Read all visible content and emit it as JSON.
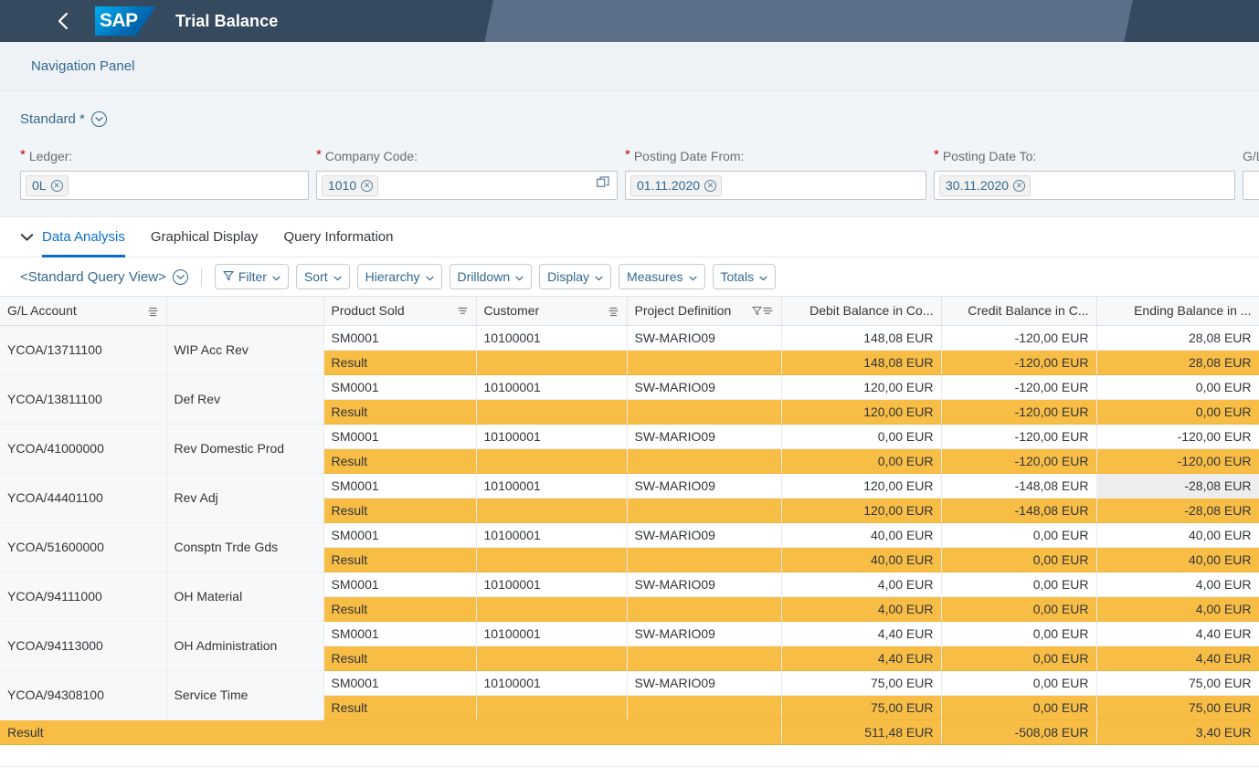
{
  "shell": {
    "back_icon": "chevron-left-icon",
    "logo_text": "SAP",
    "title": "Trial Balance"
  },
  "nav_panel": {
    "label": "Navigation Panel"
  },
  "filter_bar": {
    "variant": "Standard *",
    "variant_icon": "chevron-down-circle-icon",
    "fields": [
      {
        "label": "Ledger:",
        "required": true,
        "value": "0L",
        "has_value_help": false
      },
      {
        "label": "Company Code:",
        "required": true,
        "value": "1010",
        "has_value_help": true
      },
      {
        "label": "Posting Date From:",
        "required": true,
        "value": "01.11.2020",
        "has_value_help": false
      },
      {
        "label": "Posting Date To:",
        "required": true,
        "value": "30.11.2020",
        "has_value_help": false
      },
      {
        "label": "G/L Ac",
        "required": false,
        "value": "",
        "has_value_help": false
      }
    ]
  },
  "tabs": {
    "expander_icon": "chevron-down-icon",
    "items": [
      {
        "label": "Data Analysis",
        "selected": true
      },
      {
        "label": "Graphical Display",
        "selected": false
      },
      {
        "label": "Query Information",
        "selected": false
      }
    ]
  },
  "toolbar": {
    "query_view": "<Standard Query View>",
    "query_view_icon": "chevron-down-circle-icon",
    "buttons": [
      {
        "label": "Filter",
        "icon": "filter-icon"
      },
      {
        "label": "Sort",
        "icon": ""
      },
      {
        "label": "Hierarchy",
        "icon": ""
      },
      {
        "label": "Drilldown",
        "icon": ""
      },
      {
        "label": "Display",
        "icon": ""
      },
      {
        "label": "Measures",
        "icon": ""
      },
      {
        "label": "Totals",
        "icon": ""
      }
    ]
  },
  "table": {
    "columns": [
      {
        "label": "G/L Account",
        "icon": "hierarchy-sort-icon",
        "align": "left"
      },
      {
        "label": "",
        "icon": "",
        "align": "left"
      },
      {
        "label": "Product Sold",
        "icon": "sort-descending-icon",
        "align": "left"
      },
      {
        "label": "Customer",
        "icon": "hierarchy-sort-icon",
        "align": "left"
      },
      {
        "label": "Project Definition",
        "icon": "filter-sort-icon",
        "align": "left"
      },
      {
        "label": "Debit Balance in Co...",
        "icon": "",
        "align": "right"
      },
      {
        "label": "Credit Balance in C...",
        "icon": "",
        "align": "right"
      },
      {
        "label": "Ending Balance in ...",
        "icon": "",
        "align": "right"
      }
    ],
    "result_label": "Result",
    "groups": [
      {
        "account": "YCOA/13711100",
        "account_text": "WIP Acc Rev",
        "leaf": {
          "product": "SM0001",
          "customer": "10100001",
          "project": "SW-MARIO09",
          "debit": "148,08 EUR",
          "credit": "-120,00 EUR",
          "ending": "28,08 EUR",
          "ending_selected": false
        },
        "result": {
          "debit": "148,08 EUR",
          "credit": "-120,00 EUR",
          "ending": "28,08 EUR"
        }
      },
      {
        "account": "YCOA/13811100",
        "account_text": "Def Rev",
        "leaf": {
          "product": "SM0001",
          "customer": "10100001",
          "project": "SW-MARIO09",
          "debit": "120,00 EUR",
          "credit": "-120,00 EUR",
          "ending": "0,00 EUR",
          "ending_selected": false
        },
        "result": {
          "debit": "120,00 EUR",
          "credit": "-120,00 EUR",
          "ending": "0,00 EUR"
        }
      },
      {
        "account": "YCOA/41000000",
        "account_text": "Rev Domestic Prod",
        "leaf": {
          "product": "SM0001",
          "customer": "10100001",
          "project": "SW-MARIO09",
          "debit": "0,00 EUR",
          "credit": "-120,00 EUR",
          "ending": "-120,00 EUR",
          "ending_selected": false
        },
        "result": {
          "debit": "0,00 EUR",
          "credit": "-120,00 EUR",
          "ending": "-120,00 EUR"
        }
      },
      {
        "account": "YCOA/44401100",
        "account_text": "Rev Adj",
        "leaf": {
          "product": "SM0001",
          "customer": "10100001",
          "project": "SW-MARIO09",
          "debit": "120,00 EUR",
          "credit": "-148,08 EUR",
          "ending": "-28,08 EUR",
          "ending_selected": true
        },
        "result": {
          "debit": "120,00 EUR",
          "credit": "-148,08 EUR",
          "ending": "-28,08 EUR"
        }
      },
      {
        "account": "YCOA/51600000",
        "account_text": "Consptn Trde Gds",
        "leaf": {
          "product": "SM0001",
          "customer": "10100001",
          "project": "SW-MARIO09",
          "debit": "40,00 EUR",
          "credit": "0,00 EUR",
          "ending": "40,00 EUR",
          "ending_selected": false
        },
        "result": {
          "debit": "40,00 EUR",
          "credit": "0,00 EUR",
          "ending": "40,00 EUR"
        }
      },
      {
        "account": "YCOA/94111000",
        "account_text": "OH Material",
        "leaf": {
          "product": "SM0001",
          "customer": "10100001",
          "project": "SW-MARIO09",
          "debit": "4,00 EUR",
          "credit": "0,00 EUR",
          "ending": "4,00 EUR",
          "ending_selected": false
        },
        "result": {
          "debit": "4,00 EUR",
          "credit": "0,00 EUR",
          "ending": "4,00 EUR"
        }
      },
      {
        "account": "YCOA/94113000",
        "account_text": "OH Administration",
        "leaf": {
          "product": "SM0001",
          "customer": "10100001",
          "project": "SW-MARIO09",
          "debit": "4,40 EUR",
          "credit": "0,00 EUR",
          "ending": "4,40 EUR",
          "ending_selected": false
        },
        "result": {
          "debit": "4,40 EUR",
          "credit": "0,00 EUR",
          "ending": "4,40 EUR"
        }
      },
      {
        "account": "YCOA/94308100",
        "account_text": "Service Time",
        "leaf": {
          "product": "SM0001",
          "customer": "10100001",
          "project": "SW-MARIO09",
          "debit": "75,00 EUR",
          "credit": "0,00 EUR",
          "ending": "75,00 EUR",
          "ending_selected": false
        },
        "result": {
          "debit": "75,00 EUR",
          "credit": "0,00 EUR",
          "ending": "75,00 EUR"
        }
      }
    ],
    "grand_total": {
      "label": "Result",
      "debit": "511,48 EUR",
      "credit": "-508,08 EUR",
      "ending": "3,40 EUR"
    }
  },
  "colors": {
    "shell_bg": "#354a5f",
    "accent": "#0a6ed1",
    "link": "#33688f",
    "result_bg": "#f8bd45",
    "required_star": "#bb0000"
  }
}
